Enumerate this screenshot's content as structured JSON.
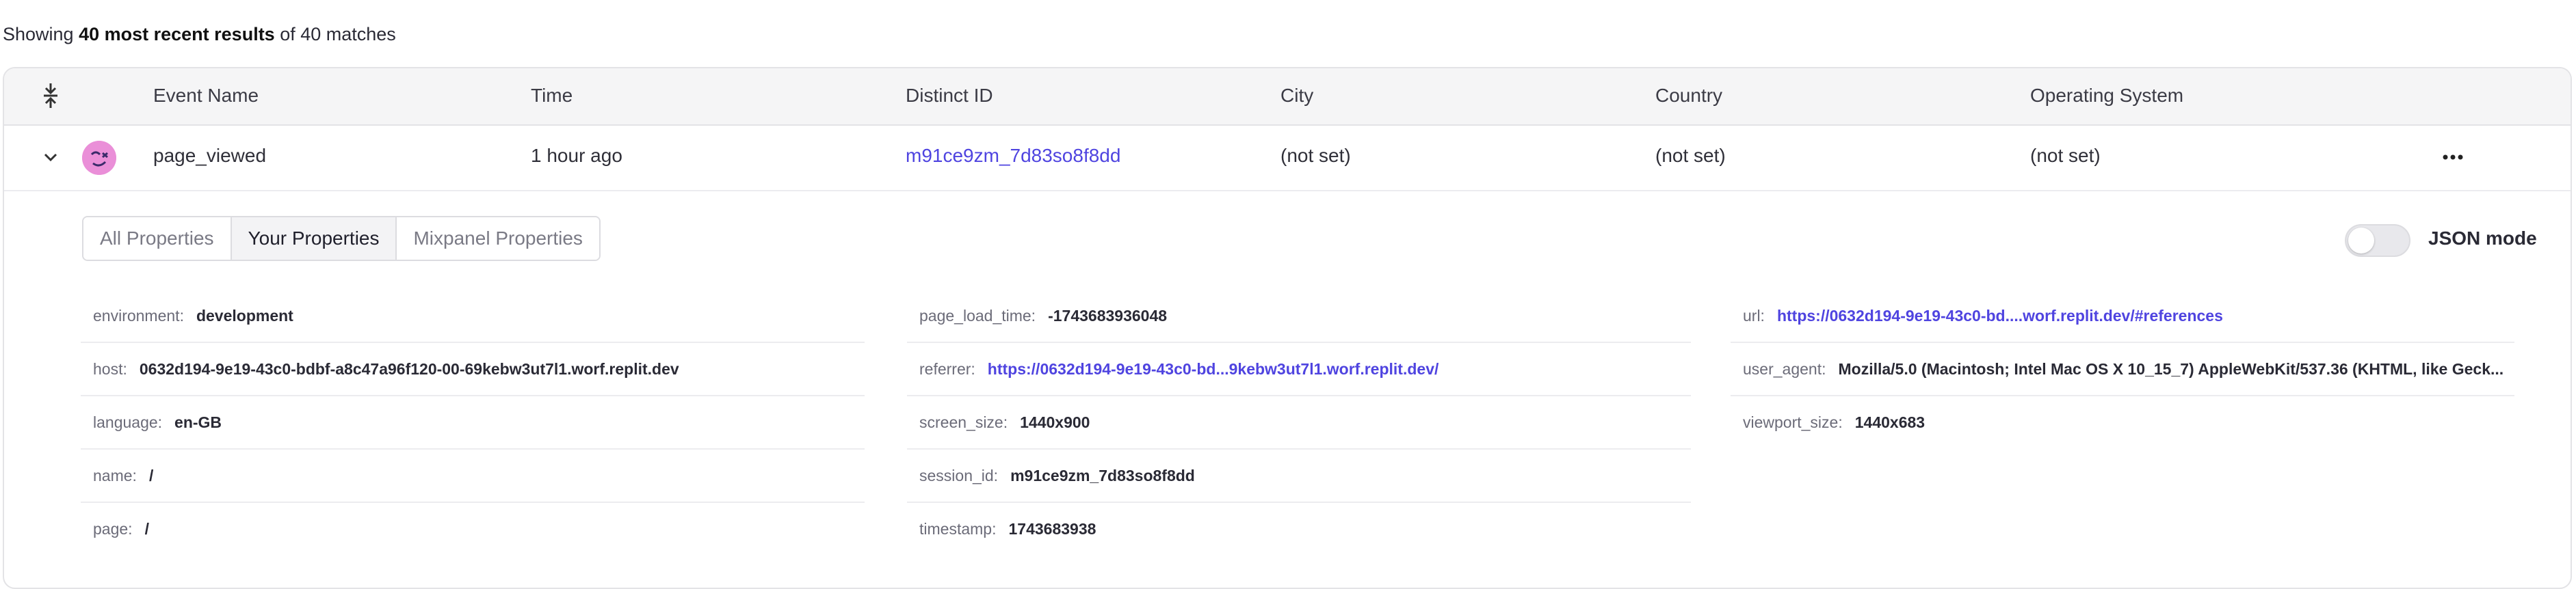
{
  "results": {
    "prefix": "Showing ",
    "bold": "40 most recent results",
    "suffix": " of 40 matches"
  },
  "columns": [
    "Event Name",
    "Time",
    "Distinct ID",
    "City",
    "Country",
    "Operating System"
  ],
  "event": {
    "name": "page_viewed",
    "time": "1 hour ago",
    "distinct_id": "m91ce9zm_7d83so8f8dd",
    "city": "(not set)",
    "country": "(not set)",
    "os": "(not set)"
  },
  "tabs": [
    "All Properties",
    "Your Properties",
    "Mixpanel Properties"
  ],
  "active_tab": "Your Properties",
  "json_mode": {
    "label": "JSON mode",
    "enabled": false
  },
  "properties": {
    "col1": [
      {
        "key": "environment:",
        "value": "development"
      },
      {
        "key": "host:",
        "value": "0632d194-9e19-43c0-bdbf-a8c47a96f120-00-69kebw3ut7l1.worf.replit.dev"
      },
      {
        "key": "language:",
        "value": "en-GB"
      },
      {
        "key": "name:",
        "value": "/"
      },
      {
        "key": "page:",
        "value": "/"
      }
    ],
    "col2": [
      {
        "key": "page_load_time:",
        "value": "-1743683936048"
      },
      {
        "key": "referrer:",
        "value": "https://0632d194-9e19-43c0-bd...9kebw3ut7l1.worf.replit.dev/"
      },
      {
        "key": "screen_size:",
        "value": "1440x900"
      },
      {
        "key": "session_id:",
        "value": "m91ce9zm_7d83so8f8dd"
      },
      {
        "key": "timestamp:",
        "value": "1743683938"
      }
    ],
    "col3": [
      {
        "key": "url:",
        "value": "https://0632d194-9e19-43c0-bd....worf.replit.dev/#references"
      },
      {
        "key": "user_agent:",
        "value": "Mozilla/5.0 (Macintosh; Intel Mac OS X 10_15_7) AppleWebKit/537.36 (KHTML, like Geck..."
      },
      {
        "key": "viewport_size:",
        "value": "1440x683"
      }
    ]
  },
  "colors": {
    "link": "#4f44e0",
    "avatar": "#ea8fd8"
  }
}
